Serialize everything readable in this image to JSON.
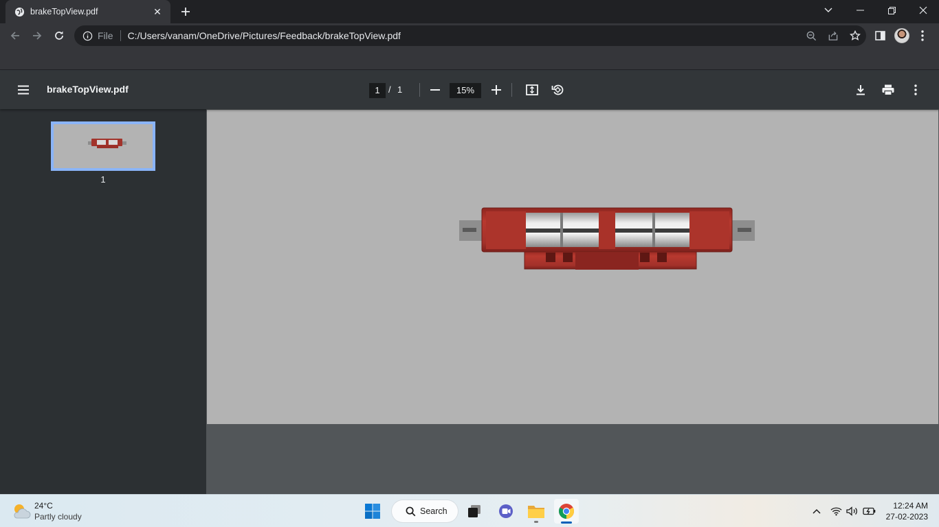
{
  "tab": {
    "title": "brakeTopView.pdf",
    "close_icon": "close-icon",
    "favicon": "globe-icon"
  },
  "toolbar": {
    "scheme": "File",
    "url": "C:/Users/vanam/OneDrive/Pictures/Feedback/brakeTopView.pdf"
  },
  "pdf": {
    "title": "brakeTopView.pdf",
    "current_page": "1",
    "separator": "/",
    "total_pages": "1",
    "zoom": "15%"
  },
  "sidebar": {
    "thumbnail_label": "1"
  },
  "colors": {
    "accent": "#8ab4f8",
    "brake_red": "#b0332b",
    "page_gray": "#b3b3b3"
  },
  "taskbar": {
    "weather_temp": "24°C",
    "weather_desc": "Partly cloudy",
    "search_label": "Search",
    "time": "12:24 AM",
    "date": "27-02-2023"
  }
}
